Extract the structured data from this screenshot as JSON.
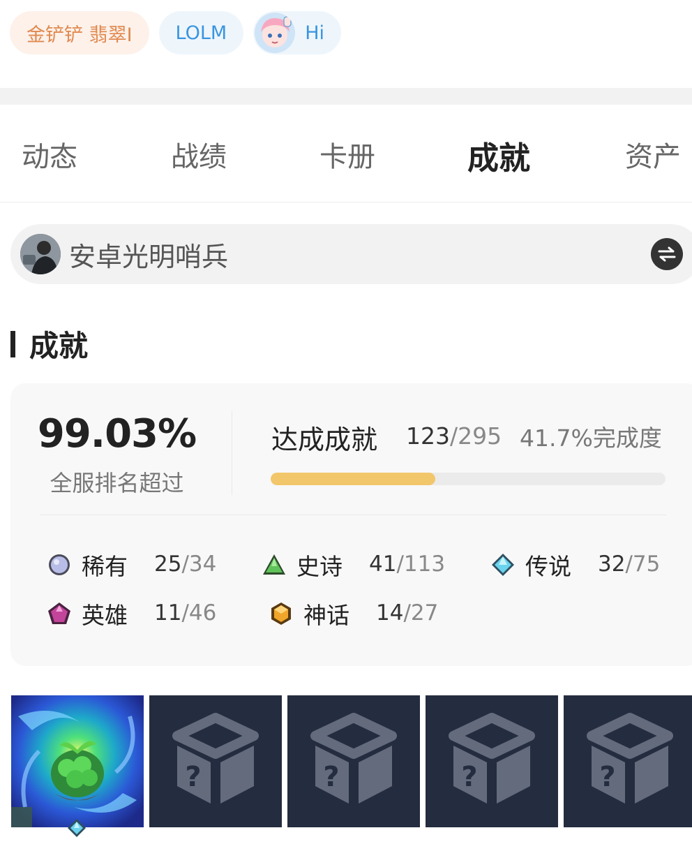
{
  "top_tags": {
    "game_rank": "金铲铲 翡翠I",
    "lolm": "LOLM",
    "hi": "Hi"
  },
  "tabs": [
    {
      "label": "动态",
      "active": false
    },
    {
      "label": "战绩",
      "active": false
    },
    {
      "label": "卡册",
      "active": false
    },
    {
      "label": "成就",
      "active": true
    },
    {
      "label": "资产",
      "active": false
    }
  ],
  "account": {
    "name": "安卓光明哨兵",
    "switch_icon": "switch-arrows-icon"
  },
  "section": {
    "title": "成就"
  },
  "stats": {
    "rank_percent": "99.03%",
    "rank_label": "全服排名超过",
    "achieved_label": "达成成就",
    "achieved": "123",
    "total": "/295",
    "completion": "41.7%完成度",
    "progress_fraction": 0.417,
    "progress_color": "#f2c66a"
  },
  "rarities": [
    {
      "name": "稀有",
      "count": "25",
      "total": "/34",
      "icon": "circle-gem-icon",
      "color": "#b8bde8"
    },
    {
      "name": "史诗",
      "count": "41",
      "total": "/113",
      "icon": "triangle-gem-icon",
      "color": "#5fc25a"
    },
    {
      "name": "传说",
      "count": "32",
      "total": "/75",
      "icon": "diamond-gem-icon",
      "color": "#6ad3ee"
    },
    {
      "name": "英雄",
      "count": "11",
      "total": "/46",
      "icon": "pentagon-gem-icon",
      "color": "#c2449b"
    },
    {
      "name": "神话",
      "count": "14",
      "total": "/27",
      "icon": "hexagon-gem-icon",
      "color": "#f0a62a"
    }
  ],
  "tiles": [
    {
      "state": "unlocked",
      "icon": "plant-vortex-icon",
      "badge": "diamond-gem-icon"
    },
    {
      "state": "locked",
      "icon": "mystery-box-icon"
    },
    {
      "state": "locked",
      "icon": "mystery-box-icon"
    },
    {
      "state": "locked",
      "icon": "mystery-box-icon"
    },
    {
      "state": "locked",
      "icon": "mystery-box-icon"
    }
  ]
}
